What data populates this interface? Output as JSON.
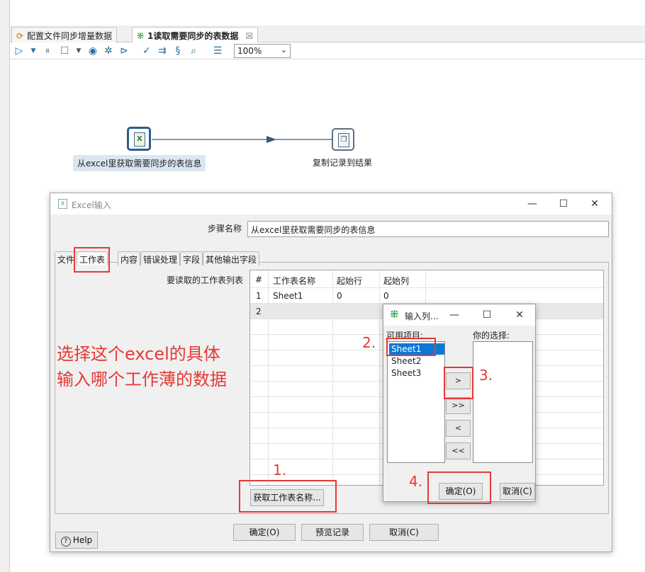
{
  "editor_tabs": [
    {
      "label": "配置文件同步增量数据",
      "active": false
    },
    {
      "label": "1读取需要同步的表数据",
      "active": true
    }
  ],
  "toolbar": {
    "zoom_value": "100%",
    "icons": [
      "run-icon",
      "dropdown-icon",
      "pause-icon",
      "stop-icon",
      "dropdown-icon",
      "preview-icon",
      "debug-icon",
      "replay-icon",
      "verify-icon",
      "impact-icon",
      "sql-icon",
      "explore-db-icon",
      "show-results-icon"
    ]
  },
  "canvas": {
    "nodes": [
      {
        "label": "从excel里获取需要同步的表信息",
        "icon": "excel-input-icon",
        "selected": true
      },
      {
        "label": "复制记录到结果",
        "icon": "copy-rows-icon",
        "selected": false
      }
    ]
  },
  "dialog": {
    "title": "Excel输入",
    "step_name_label": "步骤名称",
    "step_name_value": "从excel里获取需要同步的表信息",
    "tabs": [
      "文件",
      "工作表",
      "内容",
      "错误处理",
      "字段",
      "其他输出字段"
    ],
    "active_tab": "工作表",
    "sheet_list_label": "要读取的工作表列表",
    "grid": {
      "columns": [
        "#",
        "工作表名称",
        "起始行",
        "起始列"
      ],
      "rows": [
        [
          "1",
          "Sheet1",
          "0",
          "0"
        ],
        [
          "2",
          "",
          "",
          ""
        ]
      ]
    },
    "get_sheets_button": "获取工作表名称...",
    "help_button": "Help",
    "ok_button": "确定(O)",
    "preview_button": "预览记录",
    "cancel_button": "取消(C)"
  },
  "sub_dialog": {
    "title": "输入列...",
    "available_label": "可用项目:",
    "selected_label": "你的选择:",
    "available_items": [
      "Sheet1",
      "Sheet2",
      "Sheet3"
    ],
    "selected_item": "Sheet1",
    "move_buttons": [
      ">",
      ">>",
      "<",
      "<<"
    ],
    "ok_button": "确定(O)",
    "cancel_button": "取消(C)"
  },
  "annotations": {
    "main_note_line1": "选择这个excel的具体",
    "main_note_line2": "输入哪个工作薄的数据",
    "step1": "1.",
    "step2": "2.",
    "step3": "3.",
    "step4": "4."
  },
  "colors": {
    "annotation_red": "#e53935",
    "selection_blue": "#0a78d7"
  }
}
